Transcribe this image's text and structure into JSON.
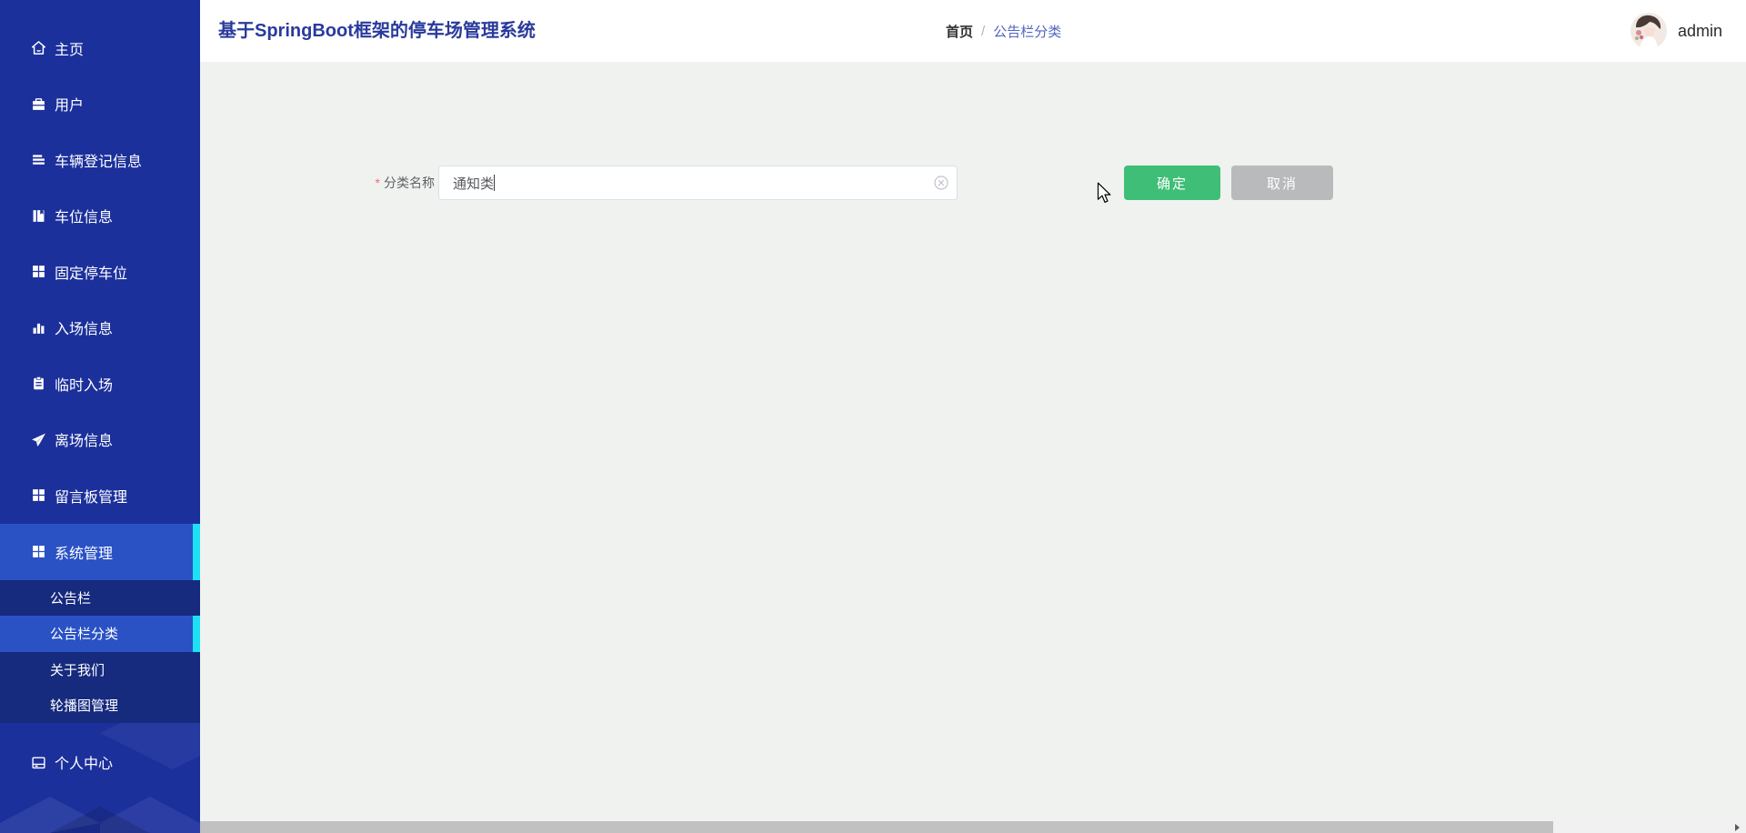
{
  "app": {
    "title": "基于SpringBoot框架的停车场管理系统"
  },
  "header": {
    "breadcrumb": {
      "root": "首页",
      "separator": "/",
      "current": "公告栏分类"
    },
    "user": {
      "name": "admin"
    }
  },
  "sidebar": {
    "items": [
      {
        "label": "主页",
        "icon": "home-icon"
      },
      {
        "label": "用户",
        "icon": "briefcase-icon"
      },
      {
        "label": "车辆登记信息",
        "icon": "list-icon"
      },
      {
        "label": "车位信息",
        "icon": "book-icon"
      },
      {
        "label": "固定停车位",
        "icon": "grid-icon"
      },
      {
        "label": "入场信息",
        "icon": "bar-chart-icon"
      },
      {
        "label": "临时入场",
        "icon": "clipboard-icon"
      },
      {
        "label": "离场信息",
        "icon": "send-icon"
      },
      {
        "label": "留言板管理",
        "icon": "grid-icon"
      },
      {
        "label": "系统管理",
        "icon": "grid-icon",
        "active": true
      },
      {
        "label": "个人中心",
        "icon": "window-icon"
      }
    ],
    "submenu": [
      {
        "label": "公告栏"
      },
      {
        "label": "公告栏分类",
        "selected": true
      },
      {
        "label": "关于我们"
      },
      {
        "label": "轮播图管理"
      }
    ]
  },
  "form": {
    "required_mark": "*",
    "category_label": "分类名称",
    "category_value": "通知类",
    "confirm_label": "确定",
    "cancel_label": "取消"
  },
  "colors": {
    "sidebar_bg": "#1c309c",
    "submenu_bg": "#162a7e",
    "active_item_bg": "#2a52c5",
    "accent_cyan": "#1ee0f4",
    "title_color": "#293a9c",
    "breadcrumb_current": "#5265c0",
    "confirm_green": "#3ebe77",
    "cancel_gray": "#b9babc",
    "required_red": "#f56c6c",
    "content_bg": "#f0f2f0"
  }
}
